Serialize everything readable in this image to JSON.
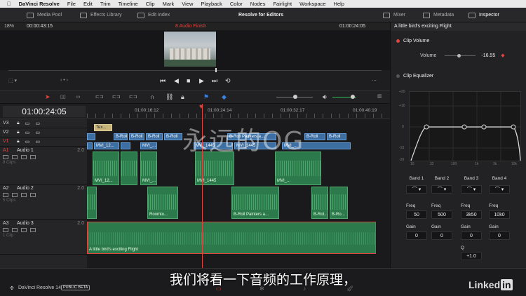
{
  "menubar": {
    "app": "DaVinci Resolve",
    "items": [
      "File",
      "Edit",
      "Trim",
      "Timeline",
      "Clip",
      "Mark",
      "View",
      "Playback",
      "Color",
      "Nodes",
      "Fairlight",
      "Workspace",
      "Help"
    ]
  },
  "toolbar": {
    "media_pool": "Media Pool",
    "effects_library": "Effects Library",
    "edit_index": "Edit Index",
    "project_title": "Resolve for Editors",
    "mixer": "Mixer",
    "metadata": "Metadata",
    "inspector": "Inspector"
  },
  "viewer": {
    "zoom": "18%",
    "source_tc": "00:00:43:15",
    "timeline_name": "8 Audio Finish",
    "record_tc": "01:00:24:05"
  },
  "timeline": {
    "timecode": "01:00:24:05",
    "ruler": [
      "01:00:16:12",
      "01:00:24:14",
      "01:00:32:17",
      "01:00:40:19"
    ],
    "tracks": [
      {
        "id": "V3",
        "name": ""
      },
      {
        "id": "V2",
        "name": ""
      },
      {
        "id": "V1",
        "name": ""
      },
      {
        "id": "A1",
        "name": "Audio 1",
        "level": "2.0",
        "clips": "8 Clips"
      },
      {
        "id": "A2",
        "name": "Audio 2",
        "level": "2.0",
        "clips": "5 Clips"
      },
      {
        "id": "A3",
        "name": "Audio 3",
        "level": "2.0",
        "clips": "1 Clip"
      }
    ],
    "clips": {
      "v3_title": "Tex...",
      "v2": [
        "B-Roll",
        "B-Roll",
        "B-Roll",
        "B-Roll",
        "B-Roll Painters a...",
        "B-Roll",
        "B-Roll"
      ],
      "v1": [
        "MVI_12...",
        "MVI_...",
        "MVI_1445",
        "MVI_1445",
        "MVI_..."
      ],
      "a1": [
        "MVI_12...",
        "MVI_...",
        "MVI_1445",
        "MVI_..."
      ],
      "a2": [
        "Roomto...",
        "B-Roll Painters a...",
        "B-Rol...",
        "B-Ro..."
      ],
      "a3": "A little bird's exciting Flight"
    }
  },
  "inspector": {
    "clip_title": "A little bird's exciting Flight",
    "clip_volume": "Clip Volume",
    "volume_label": "Volume",
    "volume_value": "-16.55",
    "clip_equalizer": "Clip Equalizer",
    "graph_y": [
      "+20",
      "+10",
      "0",
      "-10",
      "-20"
    ],
    "graph_x": [
      "10",
      "32",
      "100",
      "1k",
      "3k",
      "10k"
    ],
    "bands": [
      {
        "name": "Band 1",
        "freq": "50",
        "gain": "0"
      },
      {
        "name": "Band 2",
        "freq": "500",
        "gain": "0"
      },
      {
        "name": "Band 3",
        "freq": "3k50",
        "gain": "0"
      },
      {
        "name": "Band 4",
        "freq": "10k0",
        "gain": "0"
      }
    ],
    "freq_label": "Freq",
    "gain_label": "Gain",
    "q_label": "Q",
    "q_value": "+1.0"
  },
  "bottom": {
    "app_version": "DaVinci Resolve 14",
    "badge": "PUBLIC BETA",
    "subtitle": "我们将看一下音频的工作原理，",
    "watermark": "永远的OG",
    "logo_text": "Linked",
    "logo_in": "in"
  },
  "colors": {
    "accent": "#e0443e",
    "video_clip": "#3d6fa3",
    "audio_clip": "#2c7a4b"
  }
}
